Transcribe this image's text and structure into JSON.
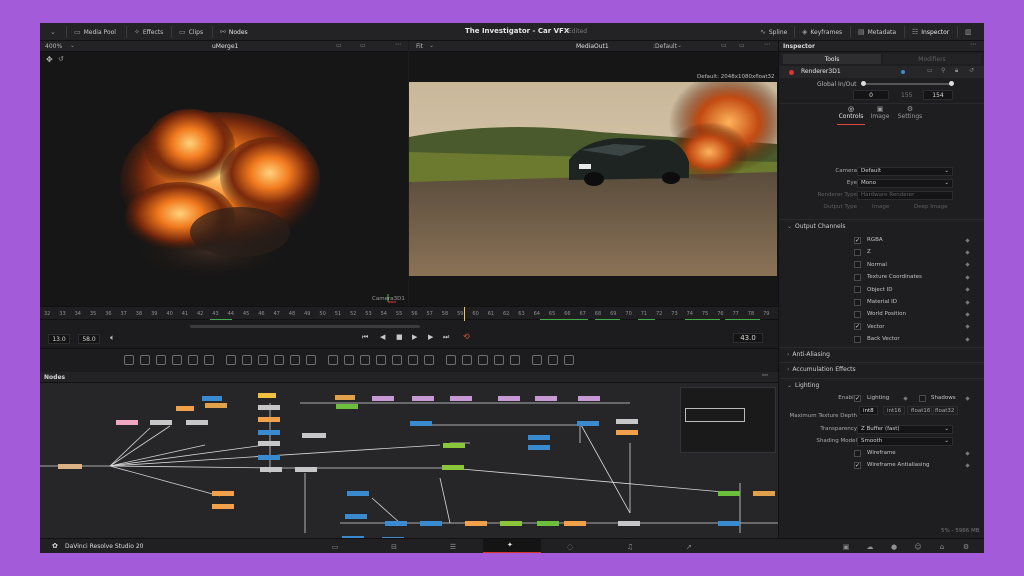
{
  "topbar": {
    "media_pool": "Media Pool",
    "effects": "Effects",
    "clips": "Clips",
    "nodes": "Nodes",
    "title": "The Investigator - Car VFX",
    "edited": "Edited",
    "spline": "Spline",
    "keyframes": "Keyframes",
    "metadata": "Metadata",
    "inspector": "Inspector"
  },
  "left_viewer": {
    "zoom": "400%",
    "name": "uMerge1",
    "camera_label": "Camera3D1"
  },
  "right_viewer": {
    "fit": "Fit",
    "name": "MediaOut1",
    "lut": ":Default",
    "resolution": "Default: 2048x1080xfloat32"
  },
  "ruler": {
    "ticks": [
      "32",
      "33",
      "34",
      "35",
      "36",
      "37",
      "38",
      "39",
      "40",
      "41",
      "42",
      "43",
      "44",
      "45",
      "46",
      "47",
      "48",
      "49",
      "50",
      "51",
      "52",
      "53",
      "54",
      "55",
      "56",
      "57",
      "58",
      "59",
      "60",
      "61",
      "62",
      "63",
      "64",
      "65",
      "66",
      "67",
      "68",
      "69",
      "70",
      "71",
      "72",
      "73",
      "74",
      "75",
      "76",
      "77",
      "78",
      "79"
    ]
  },
  "transport": {
    "start": "13.0",
    "end": "58.0",
    "current": "43.0"
  },
  "nodes_panel": {
    "title": "Nodes"
  },
  "inspector": {
    "header": "Inspector",
    "tab_tools": "Tools",
    "tab_modifiers": "Modifiers",
    "node_name": "Renderer3D1",
    "global_label": "Global In/Out",
    "global_in": "0",
    "global_mid": "155",
    "global_out": "154",
    "sub_controls": "Controls",
    "sub_image": "Image",
    "sub_settings": "Settings",
    "camera_label": "Camera",
    "camera_value": "Default",
    "eye_label": "Eye",
    "eye_value": "Mono",
    "renderer_label": "Renderer Type",
    "renderer_value": "Hardware Renderer",
    "output_label": "Output Type",
    "output_image": "Image",
    "output_deep": "Deep Image",
    "output_channels": "Output Channels",
    "channels": [
      {
        "label": "RGBA",
        "checked": true
      },
      {
        "label": "Z",
        "checked": false
      },
      {
        "label": "Normal",
        "checked": false
      },
      {
        "label": "Texture Coordinates",
        "checked": false
      },
      {
        "label": "Object ID",
        "checked": false
      },
      {
        "label": "Material ID",
        "checked": false
      },
      {
        "label": "World Position",
        "checked": false
      },
      {
        "label": "Vector",
        "checked": true
      },
      {
        "label": "Back Vector",
        "checked": false
      }
    ],
    "anti_aliasing": "Anti-Aliasing",
    "accumulation": "Accumulation Effects",
    "lighting": "Lighting",
    "enable_label": "Enable",
    "lighting_check": "Lighting",
    "shadows_check": "Shadows",
    "max_tex_label": "Maximum Texture Depth",
    "tex_options": [
      "int8",
      "int16",
      "float16",
      "float32"
    ],
    "transparency_label": "Transparency",
    "transparency_value": "Z Buffer (fast)",
    "shading_label": "Shading Model",
    "shading_value": "Smooth",
    "wireframe": "Wireframe",
    "wireframe_aa": "Wireframe Antialiasing"
  },
  "status": {
    "brand": "DaVinci Resolve Studio 20",
    "memory": "5% - 5966 MB"
  }
}
